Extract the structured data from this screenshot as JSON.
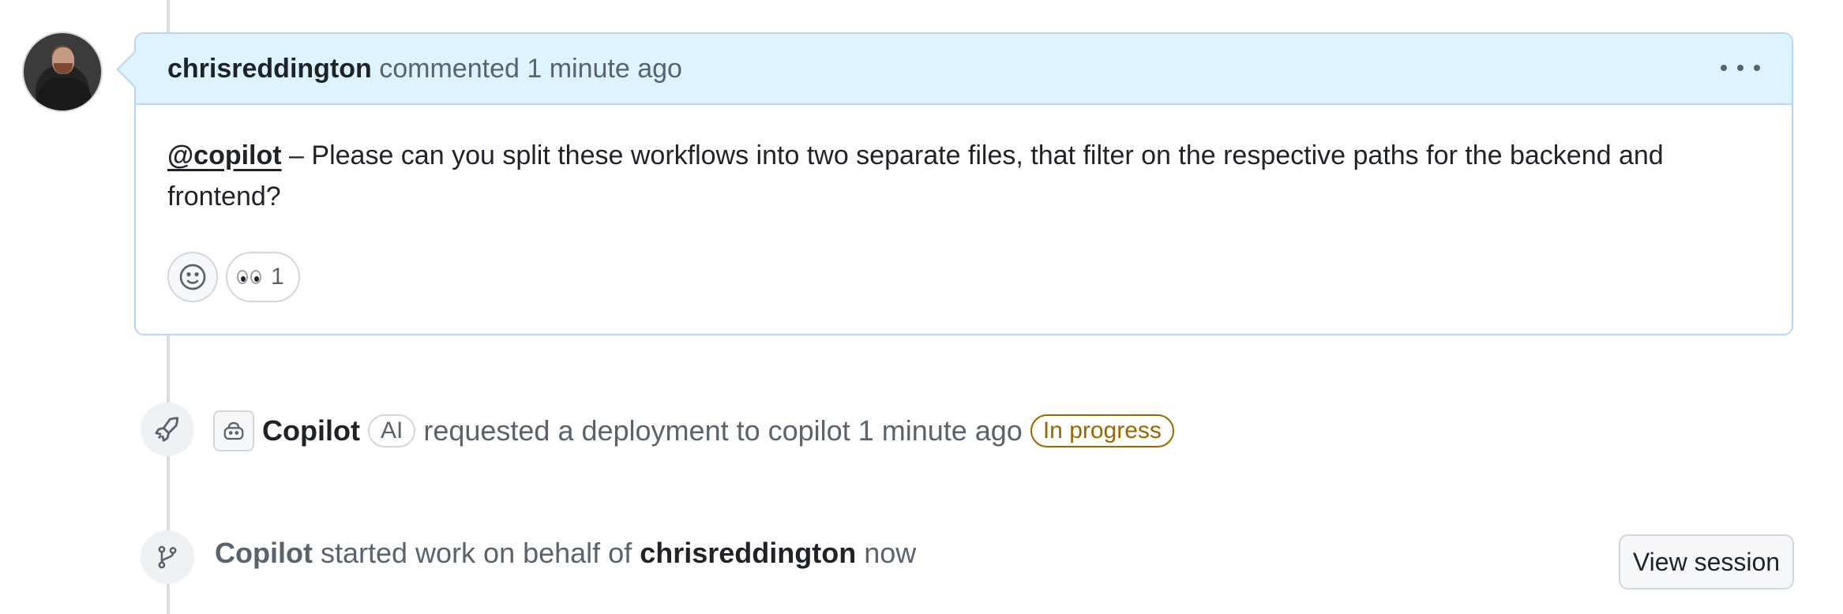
{
  "comment": {
    "author": "chrisreddington",
    "action": "commented",
    "time": "1 minute ago",
    "mention": "@copilot",
    "body": " – Please can you split these workflows into two separate files, that filter on the respective paths for the backend and frontend?",
    "reaction": {
      "emoji_name": "eyes",
      "count": "1"
    }
  },
  "events": [
    {
      "icon": "rocket-icon",
      "actor": "Copilot",
      "badge": "AI",
      "text": "requested a deployment to copilot",
      "time": "1 minute ago",
      "status": "In progress"
    },
    {
      "icon": "git-branch-icon",
      "actor": "Copilot",
      "text": "started work on behalf of",
      "user": "chrisreddington",
      "time": "now",
      "button_label": "View session"
    }
  ],
  "colors": {
    "header_bg": "#ddf4ff",
    "header_border": "#b6d7f5",
    "status_in_progress": "#9a6700",
    "muted_text": "#59636e"
  }
}
